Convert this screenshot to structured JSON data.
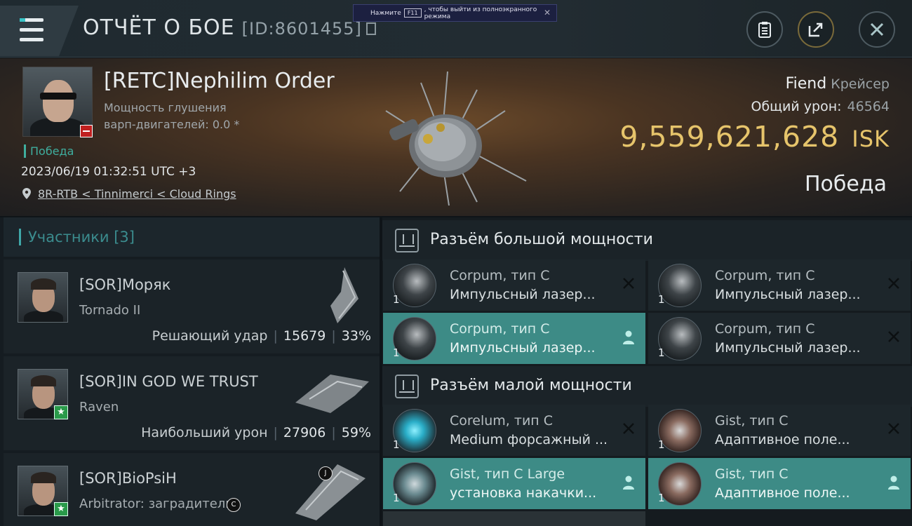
{
  "header": {
    "title": "ОТЧЁТ О БОЕ",
    "id_label": "[ID:8601455]"
  },
  "fullscreen_banner": {
    "prefix": "Нажмите",
    "key": "F11",
    "suffix": ", чтобы выйти из полноэкранного режима"
  },
  "victim": {
    "name": "[RETC]Nephilim Order",
    "warp_line1": "Мощность глушения",
    "warp_line2": "варп-двигателей: 0.0 *",
    "status": "Победа",
    "datetime": "2023/06/19 01:32:51 UTC +3",
    "location": "8R-RTB < Tinnimerci < Cloud Rings",
    "ship_name": "Fiend",
    "ship_class": "Крейсер",
    "damage_label": "Общий урон:",
    "damage_value": "46564",
    "isk_value": "9,559,621,628",
    "isk_unit": "ISK",
    "result": "Победа"
  },
  "participants": {
    "header": "Участники [3]",
    "list": [
      {
        "name": "[SOR]Моряк",
        "ship": "Tornado II",
        "stat_label": "Решающий удар",
        "damage": "15679",
        "percent": "33%"
      },
      {
        "name": "[SOR]IN GOD WE TRUST",
        "ship": "Raven",
        "stat_label": "Наибольший урон",
        "damage": "27906",
        "percent": "59%"
      },
      {
        "name": "[SOR]BioPsiH",
        "ship": "Arbitrator: заградитель"
      }
    ]
  },
  "fittings": {
    "high": {
      "title": "Разъём большой мощности",
      "slots": [
        {
          "qty": "1",
          "line1": "Corpum, тип C",
          "line2": "Импульсный лазер..."
        },
        {
          "qty": "1",
          "line1": "Corpum, тип C",
          "line2": "Импульсный лазер..."
        },
        {
          "qty": "1",
          "line1": "Corpum, тип C",
          "line2": "Импульсный лазер..."
        },
        {
          "qty": "1",
          "line1": "Corpum, тип C",
          "line2": "Импульсный лазер..."
        }
      ]
    },
    "low": {
      "title": "Разъём малой мощности",
      "slots": [
        {
          "qty": "1",
          "line1": "Corelum, тип C",
          "line2": "Medium форсажный ..."
        },
        {
          "qty": "1",
          "line1": "Gist, тип C",
          "line2": "Адаптивное поле..."
        },
        {
          "qty": "1",
          "line1": "Gist, тип C Large",
          "line2": "установка накачки..."
        },
        {
          "qty": "1",
          "line1": "Gist, тип C",
          "line2": "Адаптивное поле..."
        }
      ]
    }
  },
  "colors": {
    "accent_teal": "#3d8b86",
    "isk_gold": "#e6c46b",
    "victory_green": "#3fae9e"
  }
}
